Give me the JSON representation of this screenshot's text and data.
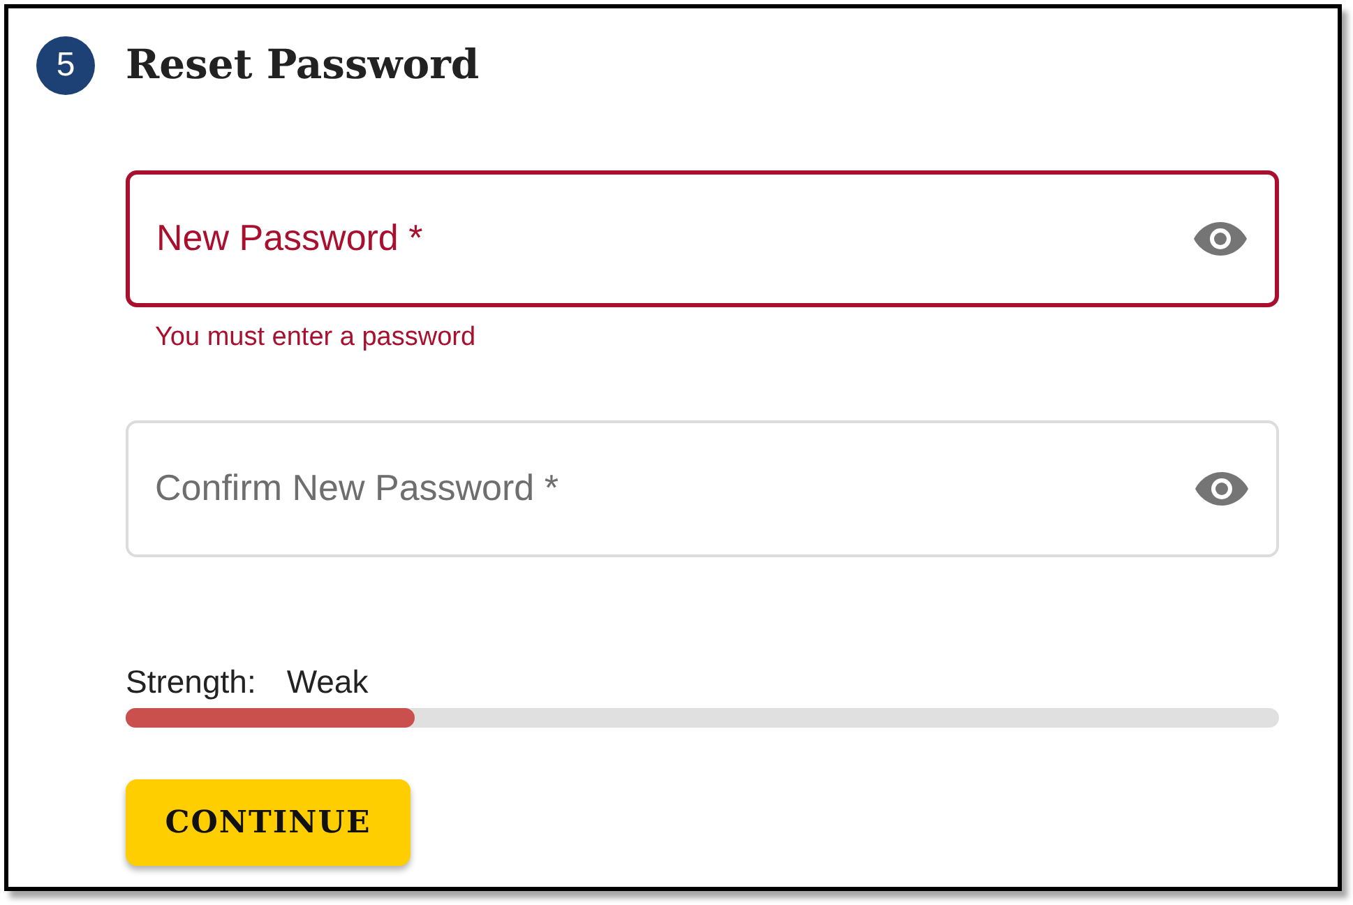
{
  "step": {
    "number": "5",
    "title": "Reset Password"
  },
  "fields": [
    {
      "label": "New Password *",
      "error": true,
      "error_message": "You must enter a password"
    },
    {
      "label": "Confirm New Password *",
      "error": false
    }
  ],
  "strength": {
    "label": "Strength:",
    "value": "Weak",
    "level": 0.25
  },
  "button": {
    "label": "CONTINUE"
  }
}
